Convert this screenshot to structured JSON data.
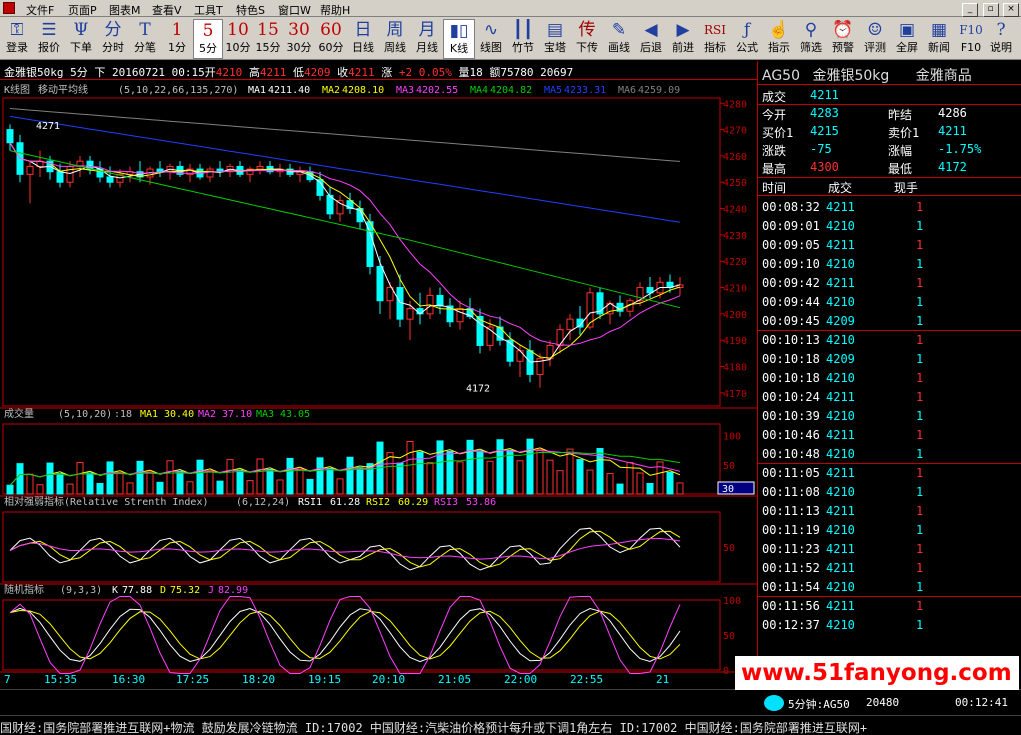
{
  "menu": {
    "items": [
      "文件F",
      "页面P",
      "图表M",
      "查看V",
      "工具T",
      "特色S",
      "窗口W",
      "帮助H"
    ]
  },
  "window_controls": [
    "_",
    "▫",
    "×"
  ],
  "toolbar": {
    "buttons": [
      {
        "glyph": "⚿",
        "label": "登录"
      },
      {
        "glyph": "☰",
        "label": "报价"
      },
      {
        "glyph": "Ψ",
        "label": "下单"
      },
      {
        "glyph": "分",
        "label": "分时"
      },
      {
        "glyph": "T",
        "label": "分笔"
      },
      {
        "glyph": "1",
        "label": "1分"
      },
      {
        "glyph": "5",
        "label": "5分"
      },
      {
        "glyph": "10",
        "label": "10分"
      },
      {
        "glyph": "15",
        "label": "15分"
      },
      {
        "glyph": "30",
        "label": "30分"
      },
      {
        "glyph": "60",
        "label": "60分"
      },
      {
        "glyph": "日",
        "label": "日线"
      },
      {
        "glyph": "周",
        "label": "周线"
      },
      {
        "glyph": "月",
        "label": "月线"
      },
      {
        "glyph": "▮▯",
        "label": "K线"
      },
      {
        "glyph": "∿",
        "label": "线图"
      },
      {
        "glyph": "┃┃",
        "label": "竹节"
      },
      {
        "glyph": "▤",
        "label": "宝塔"
      },
      {
        "glyph": "传",
        "label": "下传"
      },
      {
        "glyph": "✎",
        "label": "画线"
      },
      {
        "glyph": "◀",
        "label": "后退"
      },
      {
        "glyph": "▶",
        "label": "前进"
      },
      {
        "glyph": "RSI",
        "label": "指标"
      },
      {
        "glyph": "ƒ",
        "label": "公式"
      },
      {
        "glyph": "☝",
        "label": "指示"
      },
      {
        "glyph": "⚲",
        "label": "筛选"
      },
      {
        "glyph": "⏰",
        "label": "预警"
      },
      {
        "glyph": "☺",
        "label": "评测"
      },
      {
        "glyph": "▣",
        "label": "全屏"
      },
      {
        "glyph": "▦",
        "label": "新闻"
      },
      {
        "glyph": "F10",
        "label": "F10"
      },
      {
        "glyph": "?",
        "label": "说明"
      }
    ],
    "selected": [
      "5分",
      "K线"
    ]
  },
  "info": {
    "name": "金雅银50kg",
    "period": "5分",
    "direction": "下",
    "date": "20160721",
    "time": "00:15",
    "open_label": "开",
    "open": "4210",
    "high_label": "高",
    "high": "4211",
    "low_label": "低",
    "low": "4209",
    "close_label": "收",
    "close": "4211",
    "change_label": "涨",
    "change": "+2",
    "change_pct": "0.05%",
    "volume_label": "量",
    "volume": "18",
    "amount_label": "额",
    "amount": "75780",
    "hold": "20697"
  },
  "main_panel": {
    "label": "K线图",
    "indicator": "移动平均线",
    "params": "(5,10,22,66,135,270)",
    "ma": [
      {
        "name": "MA1",
        "value": "4211.40",
        "color": "#ffffff"
      },
      {
        "name": "MA2",
        "value": "4208.10",
        "color": "#ffff00"
      },
      {
        "name": "MA3",
        "value": "4202.55",
        "color": "#ff40ff"
      },
      {
        "name": "MA4",
        "value": "4204.82",
        "color": "#00d000"
      },
      {
        "name": "MA5",
        "value": "4233.31",
        "color": "#2040ff"
      },
      {
        "name": "MA6",
        "value": "4259.09",
        "color": "#808080"
      }
    ],
    "y_ticks": [
      "4280",
      "4270",
      "4260",
      "4250",
      "4240",
      "4230",
      "4220",
      "4210",
      "4200",
      "4190",
      "4180",
      "4170"
    ],
    "annotations": {
      "high_mark": "4271",
      "low_mark": "4172"
    }
  },
  "volume_panel": {
    "label": "成交量",
    "params": "(5,10,20)",
    "value": ":18",
    "ma": [
      {
        "name": "MA1",
        "value": "30.40",
        "color": "#ffff00"
      },
      {
        "name": "MA2",
        "value": "37.10",
        "color": "#ff40ff"
      },
      {
        "name": "MA3",
        "value": "43.05",
        "color": "#00d000"
      }
    ],
    "y_ticks": [
      "100",
      "50"
    ],
    "current_box": "30"
  },
  "rsi_panel": {
    "label": "相对强弱指标(Relative Strenth Index)",
    "params": "(6,12,24)",
    "lines": [
      {
        "name": "RSI1",
        "value": "61.28",
        "color": "#ffffff"
      },
      {
        "name": "RSI2",
        "value": "60.29",
        "color": "#ffff00"
      },
      {
        "name": "RSI3",
        "value": "53.86",
        "color": "#ff40ff"
      }
    ],
    "y_ticks": [
      "50"
    ]
  },
  "kdj_panel": {
    "label": "随机指标",
    "params": "(9,3,3)",
    "lines": [
      {
        "name": "K",
        "value": "77.88",
        "color": "#ffffff"
      },
      {
        "name": "D",
        "value": "75.32",
        "color": "#ffff00"
      },
      {
        "name": "J",
        "value": "82.99",
        "color": "#ff40ff"
      }
    ],
    "y_ticks": [
      "100",
      "50",
      "0"
    ]
  },
  "x_axis": {
    "labels": [
      "7",
      "15:35",
      "16:30",
      "17:25",
      "18:20",
      "19:15",
      "20:10",
      "21:05",
      "22:00",
      "22:55",
      "21"
    ]
  },
  "quote": {
    "code": "AG50",
    "name": "金雅银50kg",
    "exchange": "金雅商品",
    "last_label": "成交",
    "last": "4211",
    "open_label": "今开",
    "open": "4283",
    "prev_label": "昨结",
    "prev": "4286",
    "bid_label": "买价1",
    "bid": "4215",
    "ask_label": "卖价1",
    "ask": "4211",
    "chg_label": "涨跌",
    "chg": "-75",
    "pct_label": "涨幅",
    "pct": "-1.75%",
    "high_label": "最高",
    "high": "4300",
    "low_label": "最低",
    "low": "4172"
  },
  "ticks": {
    "headers": [
      "时间",
      "成交",
      "现手"
    ],
    "rows": [
      {
        "time": "00:08:32",
        "price": "4211",
        "vol": "1",
        "dir": "up"
      },
      {
        "time": "00:09:01",
        "price": "4210",
        "vol": "1",
        "dir": "down"
      },
      {
        "time": "00:09:05",
        "price": "4211",
        "vol": "1",
        "dir": "up"
      },
      {
        "time": "00:09:10",
        "price": "4210",
        "vol": "1",
        "dir": "down"
      },
      {
        "time": "00:09:42",
        "price": "4211",
        "vol": "1",
        "dir": "up"
      },
      {
        "time": "00:09:44",
        "price": "4210",
        "vol": "1",
        "dir": "down"
      },
      {
        "time": "00:09:45",
        "price": "4209",
        "vol": "1",
        "dir": "down"
      },
      {
        "time": "00:10:13",
        "price": "4210",
        "vol": "1",
        "dir": "up"
      },
      {
        "time": "00:10:18",
        "price": "4209",
        "vol": "1",
        "dir": "down"
      },
      {
        "time": "00:10:18",
        "price": "4210",
        "vol": "1",
        "dir": "up"
      },
      {
        "time": "00:10:24",
        "price": "4211",
        "vol": "1",
        "dir": "up"
      },
      {
        "time": "00:10:39",
        "price": "4210",
        "vol": "1",
        "dir": "down"
      },
      {
        "time": "00:10:46",
        "price": "4211",
        "vol": "1",
        "dir": "up"
      },
      {
        "time": "00:10:48",
        "price": "4210",
        "vol": "1",
        "dir": "down"
      },
      {
        "time": "00:11:05",
        "price": "4211",
        "vol": "1",
        "dir": "up"
      },
      {
        "time": "00:11:08",
        "price": "4210",
        "vol": "1",
        "dir": "down"
      },
      {
        "time": "00:11:13",
        "price": "4211",
        "vol": "1",
        "dir": "up"
      },
      {
        "time": "00:11:19",
        "price": "4210",
        "vol": "1",
        "dir": "down"
      },
      {
        "time": "00:11:23",
        "price": "4211",
        "vol": "1",
        "dir": "up"
      },
      {
        "time": "00:11:52",
        "price": "4211",
        "vol": "1",
        "dir": "up"
      },
      {
        "time": "00:11:54",
        "price": "4210",
        "vol": "1",
        "dir": "down"
      },
      {
        "time": "00:11:56",
        "price": "4211",
        "vol": "1",
        "dir": "up"
      },
      {
        "time": "00:12:37",
        "price": "4210",
        "vol": "1",
        "dir": "down"
      }
    ]
  },
  "status": {
    "kline_label": "5分钟:AG50",
    "hold": "20480",
    "clock": "00:12:41"
  },
  "ticker": "国财经:国务院部署推进互联网+物流  鼓励发展冷链物流  ID:17002   中国财经:汽柴油价格预计每升或下调1角左右  ID:17002   中国财经:国务院部署推进互联网+",
  "watermark": "www.51fanyong.com",
  "colors": {
    "up": "#ff3030",
    "down": "#00ffff",
    "border": "#c00000",
    "grid": "#500000"
  },
  "chart_data": {
    "type": "candlestick",
    "title": "金雅银50kg 5分",
    "ylim": [
      4165,
      4282
    ],
    "candles": [
      [
        4270,
        4272,
        4262,
        4265
      ],
      [
        4265,
        4268,
        4250,
        4253
      ],
      [
        4253,
        4258,
        4242,
        4256
      ],
      [
        4256,
        4262,
        4252,
        4258
      ],
      [
        4258,
        4260,
        4251,
        4254
      ],
      [
        4254,
        4257,
        4248,
        4250
      ],
      [
        4250,
        4258,
        4248,
        4256
      ],
      [
        4256,
        4260,
        4252,
        4258
      ],
      [
        4258,
        4260,
        4253,
        4255
      ],
      [
        4255,
        4258,
        4250,
        4252
      ],
      [
        4252,
        4256,
        4248,
        4250
      ],
      [
        4250,
        4255,
        4248,
        4253
      ],
      [
        4253,
        4256,
        4250,
        4254
      ],
      [
        4254,
        4258,
        4250,
        4252
      ],
      [
        4252,
        4256,
        4249,
        4255
      ],
      [
        4255,
        4258,
        4252,
        4254
      ],
      [
        4254,
        4257,
        4251,
        4256
      ],
      [
        4256,
        4258,
        4252,
        4253
      ],
      [
        4253,
        4257,
        4250,
        4255
      ],
      [
        4255,
        4257,
        4251,
        4252
      ],
      [
        4252,
        4256,
        4250,
        4255
      ],
      [
        4255,
        4258,
        4252,
        4254
      ],
      [
        4254,
        4257,
        4252,
        4256
      ],
      [
        4256,
        4258,
        4252,
        4253
      ],
      [
        4253,
        4256,
        4250,
        4255
      ],
      [
        4255,
        4258,
        4253,
        4256
      ],
      [
        4256,
        4258,
        4253,
        4254
      ],
      [
        4254,
        4257,
        4252,
        4255
      ],
      [
        4255,
        4257,
        4252,
        4253
      ],
      [
        4253,
        4256,
        4250,
        4254
      ],
      [
        4254,
        4256,
        4250,
        4251
      ],
      [
        4251,
        4254,
        4243,
        4245
      ],
      [
        4245,
        4248,
        4236,
        4238
      ],
      [
        4238,
        4245,
        4235,
        4243
      ],
      [
        4243,
        4246,
        4238,
        4240
      ],
      [
        4240,
        4243,
        4232,
        4235
      ],
      [
        4235,
        4238,
        4215,
        4218
      ],
      [
        4218,
        4222,
        4200,
        4205
      ],
      [
        4205,
        4212,
        4198,
        4210
      ],
      [
        4210,
        4215,
        4195,
        4198
      ],
      [
        4198,
        4205,
        4190,
        4202
      ],
      [
        4202,
        4208,
        4196,
        4200
      ],
      [
        4200,
        4210,
        4198,
        4207
      ],
      [
        4207,
        4210,
        4200,
        4203
      ],
      [
        4203,
        4206,
        4195,
        4197
      ],
      [
        4197,
        4205,
        4194,
        4202
      ],
      [
        4202,
        4206,
        4198,
        4199
      ],
      [
        4199,
        4202,
        4185,
        4188
      ],
      [
        4188,
        4198,
        4186,
        4195
      ],
      [
        4195,
        4199,
        4188,
        4190
      ],
      [
        4190,
        4193,
        4180,
        4182
      ],
      [
        4182,
        4188,
        4176,
        4186
      ],
      [
        4186,
        4190,
        4174,
        4177
      ],
      [
        4177,
        4185,
        4172,
        4183
      ],
      [
        4183,
        4190,
        4180,
        4188
      ],
      [
        4188,
        4196,
        4185,
        4194
      ],
      [
        4194,
        4200,
        4190,
        4198
      ],
      [
        4198,
        4203,
        4192,
        4195
      ],
      [
        4195,
        4210,
        4194,
        4208
      ],
      [
        4208,
        4210,
        4198,
        4200
      ],
      [
        4200,
        4205,
        4196,
        4204
      ],
      [
        4204,
        4207,
        4199,
        4201
      ],
      [
        4201,
        4206,
        4199,
        4205
      ],
      [
        4205,
        4212,
        4203,
        4210
      ],
      [
        4210,
        4214,
        4206,
        4208
      ],
      [
        4208,
        4214,
        4206,
        4212
      ],
      [
        4212,
        4215,
        4208,
        4210
      ],
      [
        4210,
        4214,
        4207,
        4211
      ]
    ]
  }
}
